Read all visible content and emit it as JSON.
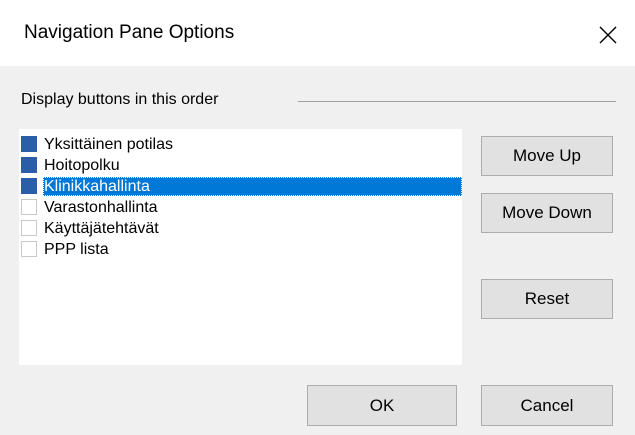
{
  "dialog": {
    "title": "Navigation Pane Options",
    "close_icon": "close-icon"
  },
  "group": {
    "label": "Display buttons in this order"
  },
  "list": {
    "items": [
      {
        "label": "Yksittäinen potilas",
        "checked": true,
        "selected": false
      },
      {
        "label": "Hoitopolku",
        "checked": true,
        "selected": false
      },
      {
        "label": "Klinikkahallinta",
        "checked": true,
        "selected": true
      },
      {
        "label": "Varastonhallinta",
        "checked": false,
        "selected": false
      },
      {
        "label": "Käyttäjätehtävät",
        "checked": false,
        "selected": false
      },
      {
        "label": "PPP lista",
        "checked": false,
        "selected": false
      }
    ]
  },
  "buttons": {
    "move_up": "Move Up",
    "move_down": "Move Down",
    "reset": "Reset",
    "ok": "OK",
    "cancel": "Cancel"
  },
  "colors": {
    "selection": "#0078d7",
    "checkbox_checked": "#2a5ea8",
    "button_face": "#e1e1e1",
    "dialog_bg": "#f0f0f0"
  }
}
